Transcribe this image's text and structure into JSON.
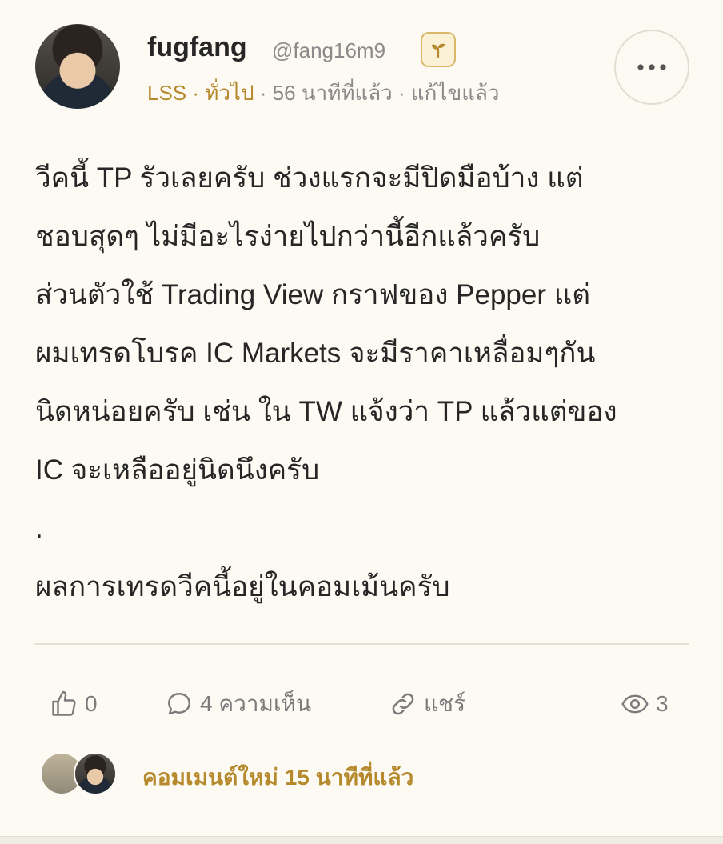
{
  "post": {
    "author": {
      "username": "fugfang",
      "handle": "@fang16m9",
      "badge_icon": "sprout-icon"
    },
    "meta": {
      "category": "LSS · ทั่วไป",
      "details": " · 56 นาทีที่แล้ว · แก้ไขแล้ว"
    },
    "body_lines": [
      "วีคนี้ TP รัวเลยครับ ช่วงแรกจะมีปิดมือบ้าง แต่",
      "ชอบสุดๆ ไม่มีอะไรง่ายไปกว่านี้อีกแล้วครับ",
      "ส่วนตัวใช้ Trading View กราฟของ Pepper แต่",
      "ผมเทรดโบรค IC Markets จะมีราคาเหลื่อมๆกัน",
      "นิดหน่อยครับ เช่น ใน TW แจ้งว่า TP แล้วแต่ของ",
      "IC จะเหลืออยู่นิดนึงครับ",
      ".",
      "ผลการเทรดวีคนี้อยู่ในคอมเม้นครับ"
    ],
    "actions": {
      "likes": "0",
      "comments": "4 ความเห็น",
      "share": "แชร์",
      "views": "3"
    },
    "comment_status": "คอมเมนต์ใหม่ 15 นาทีที่แล้ว"
  },
  "colors": {
    "background": "#fcfaf3",
    "accent": "#b5892c",
    "muted": "#8a8a8a"
  }
}
